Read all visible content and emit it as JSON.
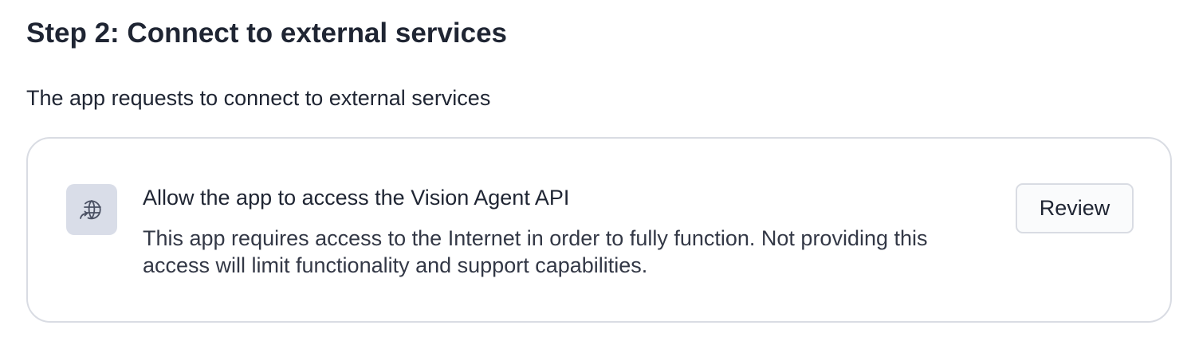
{
  "step": {
    "title": "Step 2: Connect to external services",
    "subtitle": "The app requests to connect to external services"
  },
  "permission_card": {
    "icon": "globe-arrow-icon",
    "title": "Allow the app to access the Vision Agent API",
    "description": "This app requires access to the Internet in order to fully function. Not providing this access will limit functionality and support capabilities.",
    "button_label": "Review"
  },
  "colors": {
    "text": "#1f2533",
    "card_border": "#d9dce3",
    "icon_tile_bg": "#d9dde8",
    "icon_stroke": "#4a5063"
  }
}
